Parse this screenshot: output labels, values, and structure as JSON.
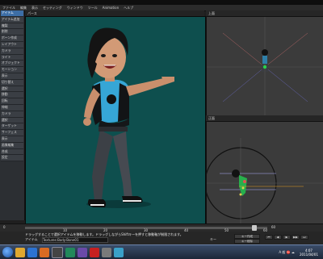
{
  "menu": [
    "ファイル",
    "編集",
    "表示",
    "セッティング",
    "ウィンドウ",
    "ツール",
    "Animation",
    "ヘルプ"
  ],
  "main_view": {
    "label": "パース"
  },
  "top_view": {
    "label": "上面"
  },
  "bottom_view": {
    "label": "正面"
  },
  "left_tools": [
    "アイテム",
    "アイテム追加",
    "複製",
    "削除",
    "ボーン作成",
    "レイアウト",
    "カメラ",
    "ライト",
    "オブジェクト",
    "モーション",
    "表示",
    "切り替え",
    "選択",
    "移動",
    "回転",
    "伸縮",
    "カメラ",
    "選択",
    "ターゲット",
    "サーフェス",
    "表示",
    "画像編集",
    "合成",
    "設定"
  ],
  "timeline": {
    "start": "0",
    "end": "60",
    "ticks": [
      "10",
      "20",
      "30",
      "40",
      "50",
      "60"
    ]
  },
  "status": {
    "line1": "ドラッグすることで選択アイテムを移動します。ドラッグしながらShiftキーを押すと移動軸が制限されます。",
    "item_label": "アイテム",
    "item_value": "Textures:Body:Bone01",
    "current_label": "キー",
    "create_key": "キー作成",
    "delete_key": "キー削除"
  },
  "taskbar": {
    "clock_time": "4:07",
    "clock_date": "2011/04/01",
    "tray_text": "A 般 ⛔ ☁"
  },
  "colors": {
    "viewport_bg": "#0e4f4e",
    "accent": "#3d6ea6"
  },
  "icons": [
    "start-orb-icon",
    "explorer-icon",
    "media-icon",
    "firefox-icon",
    "app-icon",
    "app-icon",
    "app-icon",
    "pdf-icon",
    "app-icon",
    "app-icon"
  ]
}
